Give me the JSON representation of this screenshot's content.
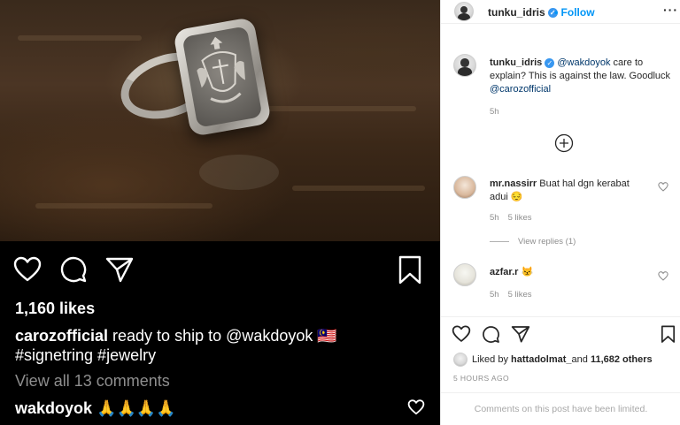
{
  "post": {
    "likes": "1,160 likes",
    "caption_user": "carozofficial",
    "caption_text": " ready to ship to @wakdoyok 🇲🇾",
    "caption_line2": "#signetring #jewelry",
    "view_all": "View all 13 comments",
    "comment_user": "wakdoyok",
    "comment_text": " 🙏🙏🙏🙏",
    "icons": [
      "heart-icon",
      "comment-icon",
      "share-icon",
      "bookmark-icon"
    ]
  },
  "header": {
    "username": "tunku_idris",
    "follow_label": "Follow",
    "dot": "•",
    "more": "···"
  },
  "comments": [
    {
      "user": "tunku_idris",
      "mention": "@wakdoyok",
      "text_a": " care to explain? This is against the law. Goodluck ",
      "mention2": "@carozofficial",
      "time": "5h"
    },
    {
      "user": "mr.nassirr",
      "text": " Buat hal dgn kerabat adui 😔",
      "time": "5h",
      "likes": "5 likes",
      "view_replies": "View replies (1)"
    },
    {
      "user": "azfar.r",
      "text": " 😾",
      "time": "5h",
      "likes": "5 likes"
    }
  ],
  "footer": {
    "liked_prefix": "Liked by ",
    "liked_user": "hattadolmat_",
    "liked_mid": " and ",
    "liked_count": "11,682 others",
    "ago": "5 HOURS AGO",
    "limited": "Comments on this post have been limited."
  },
  "colors": {
    "accent": "#0095f6",
    "verified": "#3897f0",
    "muted": "#8e8e8e"
  }
}
